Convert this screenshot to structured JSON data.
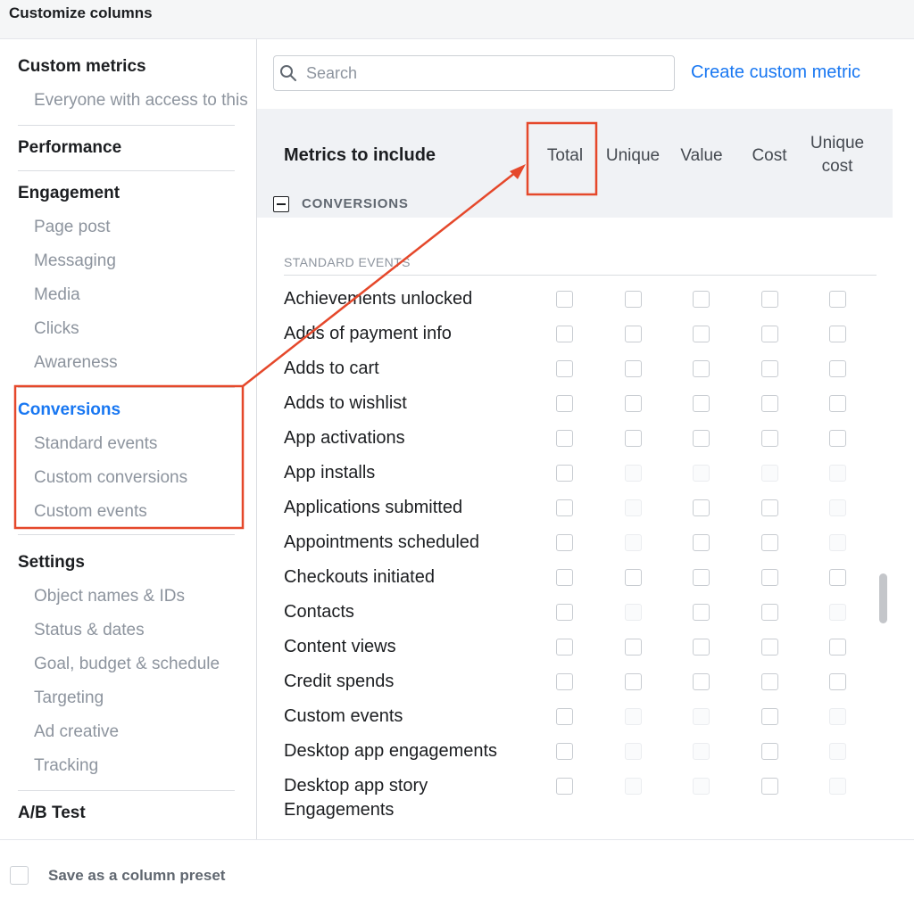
{
  "header": {
    "title": "Customize columns"
  },
  "sidebar": {
    "sections": [
      {
        "id": "custom",
        "title": "Custom metrics",
        "items": [
          "Everyone with access to this"
        ]
      },
      {
        "id": "performance",
        "title": "Performance",
        "items": []
      },
      {
        "id": "engagement",
        "title": "Engagement",
        "items": [
          "Page post",
          "Messaging",
          "Media",
          "Clicks",
          "Awareness"
        ]
      },
      {
        "id": "conversions",
        "title": "Conversions",
        "active": true,
        "items": [
          "Standard events",
          "Custom conversions",
          "Custom events"
        ]
      },
      {
        "id": "settings",
        "title": "Settings",
        "items": [
          "Object names & IDs",
          "Status & dates",
          "Goal, budget & schedule",
          "Targeting",
          "Ad creative",
          "Tracking"
        ]
      },
      {
        "id": "ab",
        "title": "A/B Test",
        "items": []
      }
    ]
  },
  "search": {
    "placeholder": "Search",
    "icon": "search-icon"
  },
  "create_link": "Create custom metric",
  "metrics": {
    "title": "Metrics to include",
    "columns": [
      {
        "key": "total",
        "label": "Total"
      },
      {
        "key": "unique",
        "label": "Unique"
      },
      {
        "key": "value",
        "label": "Value"
      },
      {
        "key": "cost",
        "label": "Cost"
      },
      {
        "key": "unique_cost",
        "label": "Unique cost"
      }
    ],
    "group_label": "CONVERSIONS",
    "subgroup_label": "STANDARD EVENTS",
    "rows": [
      {
        "name": "Achievements unlocked",
        "enabled": [
          true,
          true,
          true,
          true,
          true
        ]
      },
      {
        "name": "Adds of payment info",
        "enabled": [
          true,
          true,
          true,
          true,
          true
        ]
      },
      {
        "name": "Adds to cart",
        "enabled": [
          true,
          true,
          true,
          true,
          true
        ]
      },
      {
        "name": "Adds to wishlist",
        "enabled": [
          true,
          true,
          true,
          true,
          true
        ]
      },
      {
        "name": "App activations",
        "enabled": [
          true,
          true,
          true,
          true,
          true
        ]
      },
      {
        "name": "App installs",
        "enabled": [
          true,
          false,
          false,
          false,
          false
        ]
      },
      {
        "name": "Applications submitted",
        "enabled": [
          true,
          false,
          true,
          true,
          false
        ]
      },
      {
        "name": "Appointments scheduled",
        "enabled": [
          true,
          false,
          true,
          true,
          false
        ]
      },
      {
        "name": "Checkouts initiated",
        "enabled": [
          true,
          true,
          true,
          true,
          true
        ]
      },
      {
        "name": "Contacts",
        "enabled": [
          true,
          false,
          true,
          true,
          false
        ]
      },
      {
        "name": "Content views",
        "enabled": [
          true,
          true,
          true,
          true,
          true
        ]
      },
      {
        "name": "Credit spends",
        "enabled": [
          true,
          true,
          true,
          true,
          true
        ]
      },
      {
        "name": "Custom events",
        "enabled": [
          true,
          false,
          false,
          true,
          false
        ]
      },
      {
        "name": "Desktop app engagements",
        "enabled": [
          true,
          false,
          false,
          true,
          false
        ]
      },
      {
        "name": "Desktop app story Engagements",
        "enabled": [
          true,
          false,
          false,
          true,
          false
        ]
      }
    ]
  },
  "footer": {
    "preset_label": "Save as a column preset"
  },
  "colors": {
    "accent": "#1877f2",
    "annotation": "#e5482b"
  }
}
